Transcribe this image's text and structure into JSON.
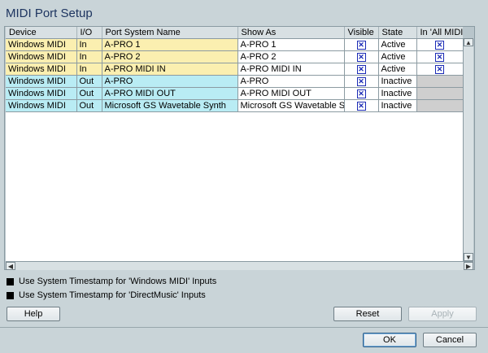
{
  "title": "MIDI Port Setup",
  "columns": [
    "Device",
    "I/O",
    "Port System Name",
    "Show As",
    "Visible",
    "State",
    "In 'All MIDI In"
  ],
  "rows": [
    {
      "device": "Windows MIDI",
      "io": "In",
      "port": "A-PRO 1",
      "show_as": "A-PRO 1",
      "visible": true,
      "state": "Active",
      "all_midi": true
    },
    {
      "device": "Windows MIDI",
      "io": "In",
      "port": "A-PRO 2",
      "show_as": "A-PRO 2",
      "visible": true,
      "state": "Active",
      "all_midi": true
    },
    {
      "device": "Windows MIDI",
      "io": "In",
      "port": "A-PRO MIDI IN",
      "show_as": "A-PRO MIDI IN",
      "visible": true,
      "state": "Active",
      "all_midi": true
    },
    {
      "device": "Windows MIDI",
      "io": "Out",
      "port": "A-PRO",
      "show_as": "A-PRO",
      "visible": true,
      "state": "Inactive",
      "all_midi": null
    },
    {
      "device": "Windows MIDI",
      "io": "Out",
      "port": "A-PRO MIDI OUT",
      "show_as": "A-PRO MIDI OUT",
      "visible": true,
      "state": "Inactive",
      "all_midi": null
    },
    {
      "device": "Windows MIDI",
      "io": "Out",
      "port": "Microsoft GS Wavetable Synth",
      "show_as": "Microsoft GS Wavetable Synth",
      "visible": true,
      "state": "Inactive",
      "all_midi": null
    }
  ],
  "options": {
    "timestamp_windows": "Use System Timestamp for 'Windows MIDI' Inputs",
    "timestamp_directmusic": "Use System Timestamp for 'DirectMusic' Inputs"
  },
  "buttons": {
    "help": "Help",
    "reset": "Reset",
    "apply": "Apply",
    "ok": "OK",
    "cancel": "Cancel"
  },
  "colors": {
    "input_row": "#fbefb0",
    "output_row": "#b9ecf4",
    "checkbox_mark": "#1b2bb5"
  },
  "icons": {
    "check": "✕",
    "scroll_up": "▲",
    "scroll_down": "▼",
    "scroll_left": "◀",
    "scroll_right": "▶"
  }
}
